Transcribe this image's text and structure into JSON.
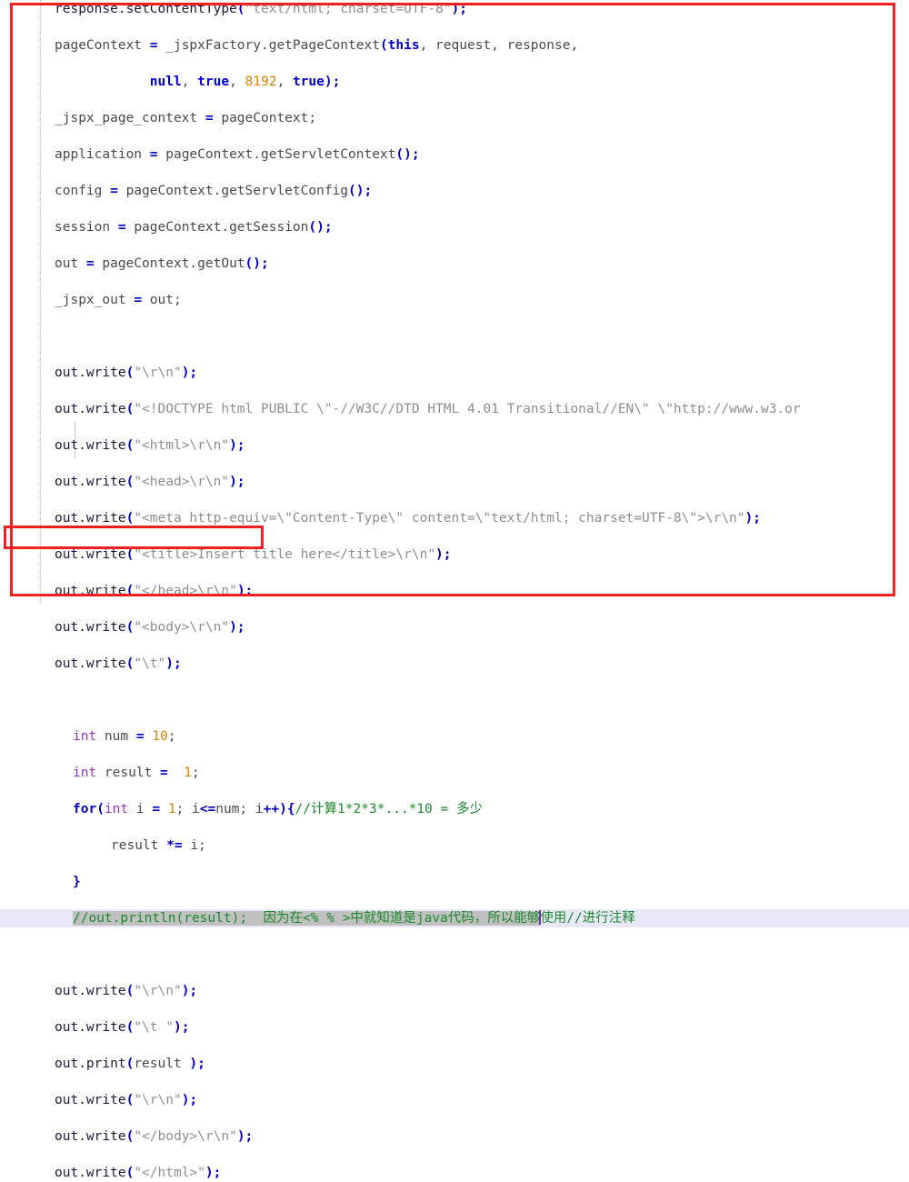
{
  "editor": {
    "kind": "java-source-editor",
    "language": "Java (generated JSP servlet)",
    "font_size_px": 14.5,
    "line_height_px": 20,
    "background": "#ffffff",
    "current_line_highlight": "#e8e8f8",
    "selection_highlight": "#c0c0c0",
    "caret_color": "#7a28c8"
  },
  "colors": {
    "annotation_red": "#f22020",
    "keyword": "#0000d0",
    "type": "#9b30d0",
    "number": "#e08000",
    "string": "#8e8e8e",
    "comment": "#1a8a2a",
    "punctuation": "#0000c0",
    "plain_text": "#4a4a4a"
  },
  "annotations": [
    {
      "name": "outer-highlight-box",
      "shape": "rectangle",
      "color": "#f22020",
      "covers": "entire visible code block"
    },
    {
      "name": "inner-highlight-box",
      "shape": "rectangle",
      "color": "#f22020",
      "covers": "out.print(result );"
    }
  ],
  "lines": [
    {
      "n": 1,
      "indent": 0,
      "text": "response.setContentType(\"text/html; charset=UTF-8\");"
    },
    {
      "n": 2,
      "indent": 0,
      "text": "pageContext = _jspxFactory.getPageContext(this, request, response,"
    },
    {
      "n": 3,
      "indent": 0,
      "text": "            null, true, 8192, true);"
    },
    {
      "n": 4,
      "indent": 0,
      "text": "_jspx_page_context = pageContext;"
    },
    {
      "n": 5,
      "indent": 0,
      "text": "application = pageContext.getServletContext();"
    },
    {
      "n": 6,
      "indent": 0,
      "text": "config = pageContext.getServletConfig();"
    },
    {
      "n": 7,
      "indent": 0,
      "text": "session = pageContext.getSession();"
    },
    {
      "n": 8,
      "indent": 0,
      "text": "out = pageContext.getOut();"
    },
    {
      "n": 9,
      "indent": 0,
      "text": "_jspx_out = out;"
    },
    {
      "n": 10,
      "indent": 0,
      "text": ""
    },
    {
      "n": 11,
      "indent": 0,
      "text": "out.write(\"\\r\\n\");"
    },
    {
      "n": 12,
      "indent": 0,
      "text": "out.write(\"<!DOCTYPE html PUBLIC \\\"-//W3C//DTD HTML 4.01 Transitional//EN\\\" \\\"http://www.w3.or"
    },
    {
      "n": 13,
      "indent": 0,
      "text": "out.write(\"<html>\\r\\n\");"
    },
    {
      "n": 14,
      "indent": 0,
      "text": "out.write(\"<head>\\r\\n\");"
    },
    {
      "n": 15,
      "indent": 0,
      "text": "out.write(\"<meta http-equiv=\\\"Content-Type\\\" content=\\\"text/html; charset=UTF-8\\\">\\r\\n\");"
    },
    {
      "n": 16,
      "indent": 0,
      "text": "out.write(\"<title>Insert title here</title>\\r\\n\");"
    },
    {
      "n": 17,
      "indent": 0,
      "text": "out.write(\"</head>\\r\\n\");"
    },
    {
      "n": 18,
      "indent": 0,
      "text": "out.write(\"<body>\\r\\n\");"
    },
    {
      "n": 19,
      "indent": 0,
      "text": "out.write(\"\\t\");"
    },
    {
      "n": 20,
      "indent": 0,
      "text": ""
    },
    {
      "n": 21,
      "indent": 1,
      "text": "  int num = 10;"
    },
    {
      "n": 22,
      "indent": 1,
      "text": "  int result =  1;"
    },
    {
      "n": 23,
      "indent": 1,
      "text": "  for(int i = 1; i<=num; i++){//计算1*2*3*...*10 = 多少"
    },
    {
      "n": 24,
      "indent": 2,
      "text": "      result *= i;"
    },
    {
      "n": 25,
      "indent": 1,
      "text": "  }"
    },
    {
      "n": 26,
      "indent": 1,
      "text": "  //out.println(result);  因为在<% % >中就知道是java代码，所以能够使用//进行注释"
    },
    {
      "n": 27,
      "indent": 0,
      "text": ""
    },
    {
      "n": 28,
      "indent": 0,
      "text": "out.write(\"\\r\\n\");"
    },
    {
      "n": 29,
      "indent": 0,
      "text": "out.write(\"\\t \");"
    },
    {
      "n": 30,
      "indent": 0,
      "text": "out.print(result );"
    },
    {
      "n": 31,
      "indent": 0,
      "text": "out.write(\"\\r\\n\");"
    },
    {
      "n": 32,
      "indent": 0,
      "text": "out.write(\"</body>\\r\\n\");"
    },
    {
      "n": 33,
      "indent": 0,
      "text": "out.write(\"</html>\");"
    }
  ],
  "tokens": {
    "l1": {
      "a": "response.setContentType",
      "b": "(",
      "c": "\"text/html; charset=UTF-8\"",
      "d": ");"
    },
    "l2": {
      "a": "pageContext ",
      "b": "= ",
      "c": "_jspxFactory.getPageContext",
      "d": "(",
      "e": "this",
      "f": ", request, response,"
    },
    "l3": {
      "pad": "            ",
      "a": "null",
      "b": ", ",
      "c": "true",
      "d": ", ",
      "e": "8192",
      "f": ", ",
      "g": "true",
      "h": ");"
    },
    "l4": {
      "a": "_jspx_page_context ",
      "b": "= ",
      "c": "pageContext;"
    },
    "l5": {
      "a": "application ",
      "b": "= ",
      "c": "pageContext.getServletContext",
      "d": "();"
    },
    "l6": {
      "a": "config ",
      "b": "= ",
      "c": "pageContext.getServletConfig",
      "d": "();"
    },
    "l7": {
      "a": "session ",
      "b": "= ",
      "c": "pageContext.getSession",
      "d": "();"
    },
    "l8": {
      "a": "out ",
      "b": "= ",
      "c": "pageContext.getOut",
      "d": "();"
    },
    "l9": {
      "a": "_jspx_out ",
      "b": "= ",
      "c": "out;"
    },
    "write_call": "out.write",
    "open": "(",
    "close": ");",
    "s11": "\"\\r\\n\"",
    "s12": "\"<!DOCTYPE html PUBLIC \\\"-//W3C//DTD HTML 4.01 Transitional//EN\\\" \\\"http://www.w3.or",
    "s13": "\"<html>\\r\\n\"",
    "s14": "\"<head>\\r\\n\"",
    "s15": "\"<meta http-equiv=\\\"Content-Type\\\" content=\\\"text/html; charset=UTF-8\\\">\\r\\n\"",
    "s16": "\"<title>Insert title here</title>\\r\\n\"",
    "s17": "\"</head>\\r\\n\"",
    "s18": "\"<body>\\r\\n\"",
    "s19": "\"\\t\"",
    "s28": "\"\\r\\n\"",
    "s29": "\"\\t \"",
    "s31": "\"\\r\\n\"",
    "s32": "\"</body>\\r\\n\"",
    "s33": "\"</html>\"",
    "l21": {
      "kw": "int",
      "name": " num ",
      "op": "= ",
      "num": "10",
      "end": ";"
    },
    "l22": {
      "kw": "int",
      "name": " result ",
      "op": "= ",
      "num": " 1",
      "end": ";"
    },
    "l23": {
      "kw": "for",
      "p1": "(",
      "type": "int",
      "mid": " i ",
      "op": "= ",
      "num": "1",
      "s1": "; i",
      "op2": "<=",
      "s2": "num; i",
      "op3": "++",
      "p2": ")",
      "brace": "{",
      "comment": "//计算1*2*3*...*10 = 多少"
    },
    "l24": {
      "a": "result ",
      "op": "*= ",
      "b": "i;"
    },
    "l25": {
      "brace": "}"
    },
    "l26": {
      "selected": "//out.println(result);  因为在<% % >中就知道是java代码，所以能够",
      "rest": "使用//进行注释"
    },
    "l30": {
      "a": "out.print",
      "b": "(",
      "c": "result ",
      "d": ");"
    }
  }
}
